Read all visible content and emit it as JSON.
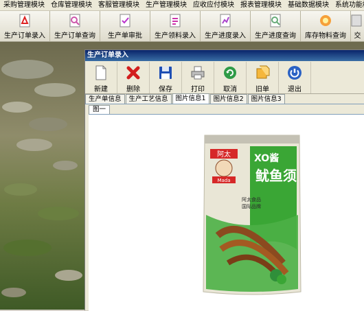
{
  "menu": {
    "items": [
      "采购管理模块",
      "仓库管理模块",
      "客服管理模块",
      "生产管理模块",
      "应收应付模块",
      "报表管理模块",
      "基础数据模块",
      "系统功能模"
    ]
  },
  "modules": {
    "items": [
      {
        "label": "生产订单录入",
        "icon": "pdf-doc-icon"
      },
      {
        "label": "生产订单查询",
        "icon": "doc-search-icon"
      },
      {
        "label": "生产单审批",
        "icon": "approve-doc-icon"
      },
      {
        "label": "生产领料录入",
        "icon": "material-doc-icon"
      },
      {
        "label": "生产进度录入",
        "icon": "progress-doc-icon"
      },
      {
        "label": "生产进度查询",
        "icon": "progress-search-icon"
      },
      {
        "label": "库存物料查询",
        "icon": "stock-search-icon"
      },
      {
        "label": "交",
        "icon": "partial-icon"
      }
    ]
  },
  "window": {
    "title": "生产订单录入",
    "toolbar": {
      "new": "新建",
      "delete": "删除",
      "save": "保存",
      "print": "打印",
      "cancel": "取消",
      "old": "旧单",
      "exit": "退出"
    },
    "tabs": [
      "生产单信息",
      "生产工艺信息",
      "图片信息1",
      "图片信息2",
      "图片信息3"
    ],
    "active_tab": "图片信息1",
    "subtab": "图一"
  },
  "product": {
    "brand": "阿太",
    "brand_en": "Mada",
    "title_top": "XO酱",
    "title_main": "鱿鱼须",
    "side_text_1": "阿太食品",
    "side_text_2": "国际品牌"
  },
  "colors": {
    "title_bar": "#0a246a",
    "package_green": "#3aa635",
    "brand_red": "#d62828"
  }
}
